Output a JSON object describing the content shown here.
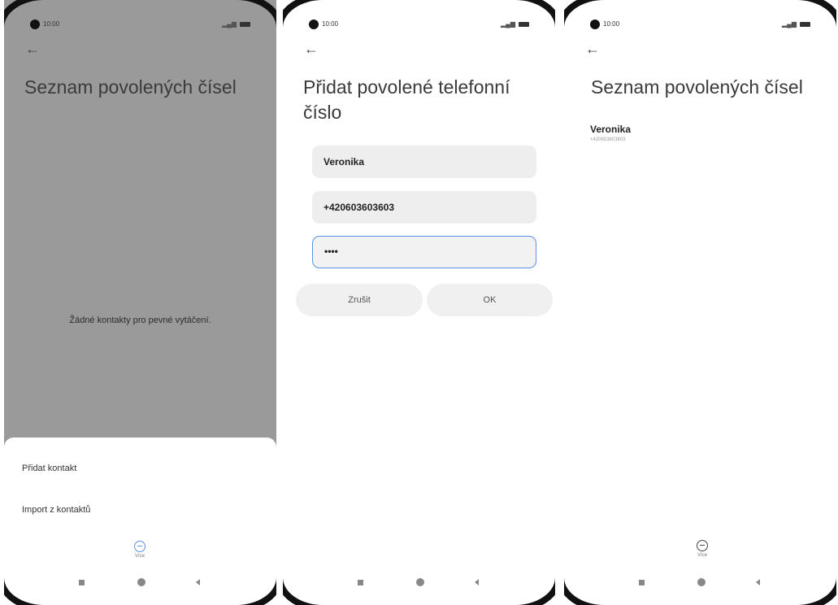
{
  "phones": [
    {
      "status_time": "10:00",
      "back": "←",
      "title": "Seznam povolených čísel",
      "empty_text": "Žádné kontakty pro pevné vytáčení.",
      "menu": [
        "Přidat kontakt",
        "Import z kontaktů"
      ],
      "more_label": "Více"
    },
    {
      "status_time": "10:00",
      "back": "←",
      "title_line1": "Přidat povolené telefonní",
      "title_line2": "číslo",
      "name_value": "Veronika",
      "phone_value": "+420603603603",
      "pin_value": "••••",
      "cancel_label": "Zrušit",
      "ok_label": "OK"
    },
    {
      "status_time": "10:00",
      "back": "←",
      "title": "Seznam povolených čísel",
      "entry_name": "Veronika",
      "entry_number": "+420603603603",
      "more_label": "Více"
    }
  ],
  "accent_color": "#5b92e5",
  "dim_color": "#9a9a9a"
}
